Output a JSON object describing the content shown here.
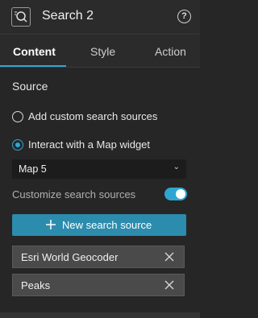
{
  "header": {
    "title": "Search 2",
    "widget_icon": "search-widget-icon",
    "help_icon": "help-icon",
    "help_glyph": "?"
  },
  "tabs": [
    {
      "label": "Content",
      "active": true
    },
    {
      "label": "Style",
      "active": false
    },
    {
      "label": "Action",
      "active": false
    }
  ],
  "source": {
    "title": "Source",
    "options": [
      {
        "label": "Add custom search sources",
        "checked": false
      },
      {
        "label": "Interact with a Map widget",
        "checked": true
      }
    ],
    "map_select": {
      "value": "Map 5",
      "arrow": "⌄"
    },
    "customize": {
      "label": "Customize search sources",
      "enabled": true
    },
    "new_button": {
      "label": "New search source"
    },
    "items": [
      {
        "label": "Esri World Geocoder"
      },
      {
        "label": "Peaks"
      }
    ]
  },
  "colors": {
    "accent": "#2fa6d1",
    "button": "#2c8cad",
    "background": "#262626"
  }
}
